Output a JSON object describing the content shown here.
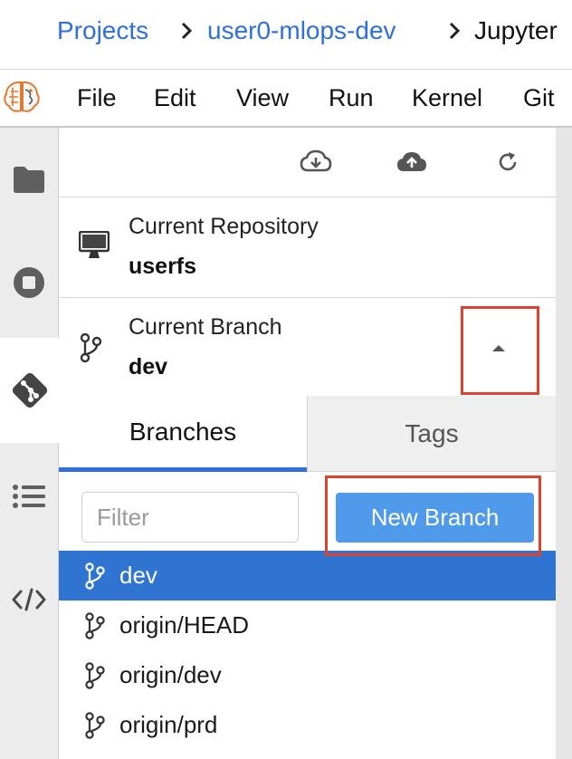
{
  "breadcrumb": {
    "items": [
      {
        "label": "Projects"
      },
      {
        "label": "user0-mlops-dev"
      },
      {
        "label": "Jupyter"
      }
    ]
  },
  "menubar": {
    "items": [
      {
        "label": "File"
      },
      {
        "label": "Edit"
      },
      {
        "label": "View"
      },
      {
        "label": "Run"
      },
      {
        "label": "Kernel"
      },
      {
        "label": "Git"
      }
    ]
  },
  "activity_bar": {
    "items": [
      {
        "icon": "folder-icon"
      },
      {
        "icon": "stop-circle-icon"
      },
      {
        "icon": "git-icon",
        "active": true
      },
      {
        "icon": "list-icon"
      },
      {
        "icon": "code-icon"
      }
    ]
  },
  "git_panel": {
    "toolbar": {
      "buttons": [
        {
          "icon": "cloud-download-icon"
        },
        {
          "icon": "cloud-upload-icon"
        },
        {
          "icon": "refresh-icon"
        }
      ]
    },
    "repository": {
      "label": "Current Repository",
      "value": "userfs"
    },
    "branch": {
      "label": "Current Branch",
      "value": "dev"
    },
    "tabs": [
      {
        "label": "Branches",
        "active": true
      },
      {
        "label": "Tags",
        "active": false
      }
    ],
    "filter": {
      "placeholder": "Filter",
      "value": ""
    },
    "new_branch_label": "New Branch",
    "branches": [
      {
        "name": "dev",
        "selected": true
      },
      {
        "name": "origin/HEAD",
        "selected": false
      },
      {
        "name": "origin/dev",
        "selected": false
      },
      {
        "name": "origin/prd",
        "selected": false
      }
    ]
  },
  "colors": {
    "link": "#2f6fdc",
    "accent": "#2f74d0",
    "button": "#4f9aea",
    "highlight": "#e0432b"
  }
}
